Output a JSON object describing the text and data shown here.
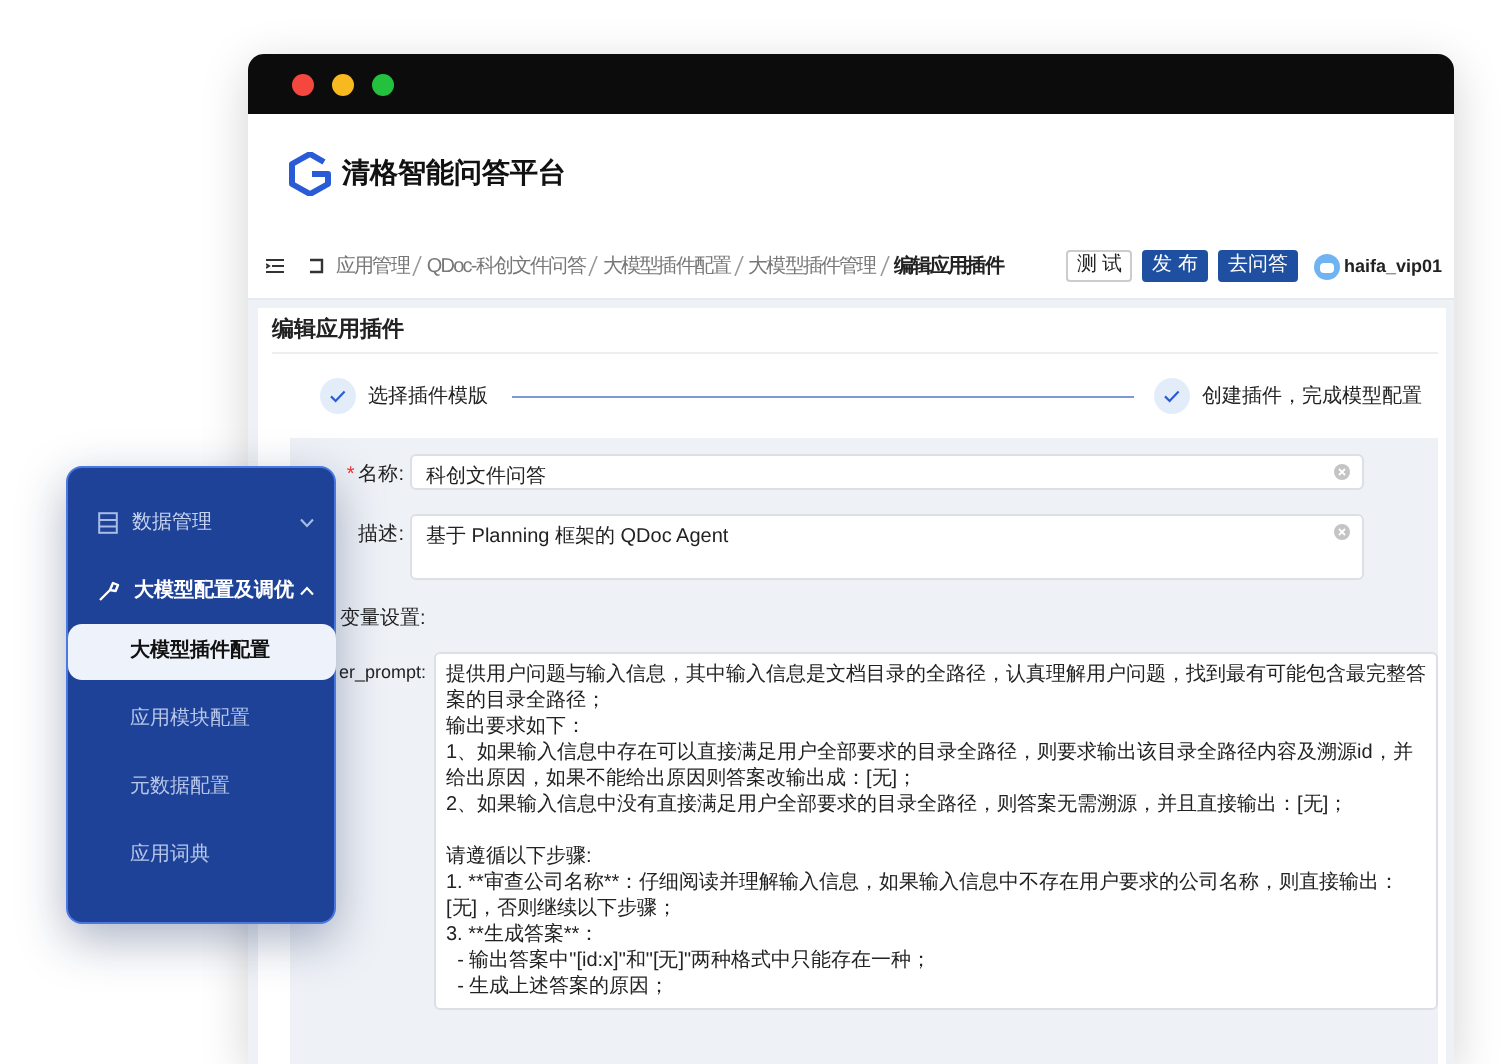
{
  "window": {
    "title_bar": true
  },
  "header": {
    "title": "清格智能问答平台"
  },
  "breadcrumb": [
    {
      "label": "应用管理",
      "current": false
    },
    {
      "label": "QDoc-科创文件问答",
      "current": false
    },
    {
      "label": "大模型插件配置",
      "current": false
    },
    {
      "label": "大模型插件管理",
      "current": false
    },
    {
      "label": "编辑应用插件",
      "current": true
    }
  ],
  "actions": [
    {
      "label": "测 试",
      "kind": "outline"
    },
    {
      "label": "发 布",
      "kind": "primary"
    },
    {
      "label": "去问答",
      "kind": "primary"
    }
  ],
  "user": {
    "name": "haifa_vip01"
  },
  "card": {
    "title": "编辑应用插件"
  },
  "steps": [
    {
      "label": "选择插件模版",
      "done": true
    },
    {
      "label": "创建插件，完成模型配置",
      "done": true
    }
  ],
  "form": {
    "name": {
      "required_mark": "*",
      "label": "名称:",
      "value": "科创文件问答"
    },
    "description": {
      "label": "描述:",
      "value": "基于 Planning 框架的 QDoc Agent"
    },
    "variables_heading": "变量设置:",
    "prompt": {
      "label": "er_prompt:",
      "lines": [
        "提供用户问题与输入信息，其中输入信息是文档目录的全路径，认真理解用户问题，找到最有可能包含最完整答案的目录全路径；",
        "输出要求如下：",
        "1、如果输入信息中存在可以直接满足用户全部要求的目录全路径，则要求输出该目录全路径内容及溯源id，并给出原因，如果不能给出原因则答案改输出成：[无]；",
        "2、如果输入信息中没有直接满足用户全部要求的目录全路径，则答案无需溯源，并且直接输出：[无]；",
        "请遵循以下步骤:",
        "1. **审查公司名称**：仔细阅读并理解输入信息，如果输入信息中不存在用户要求的公司名称，则直接输出：[无]，否则继续以下步骤；",
        "3. **生成答案**：",
        "  - 输出答案中\"[id:x]\"和\"[无]\"两种格式中只能存在一种；",
        "  - 生成上述答案的原因；"
      ]
    }
  },
  "sidebar": {
    "items": [
      {
        "label": "数据管理",
        "expanded": false
      },
      {
        "label": "大模型配置及调优",
        "expanded": true,
        "children": [
          {
            "label": "大模型插件配置",
            "selected": true
          },
          {
            "label": "应用模块配置",
            "selected": false
          },
          {
            "label": "元数据配置",
            "selected": false
          },
          {
            "label": "应用词典",
            "selected": false
          }
        ]
      }
    ]
  }
}
